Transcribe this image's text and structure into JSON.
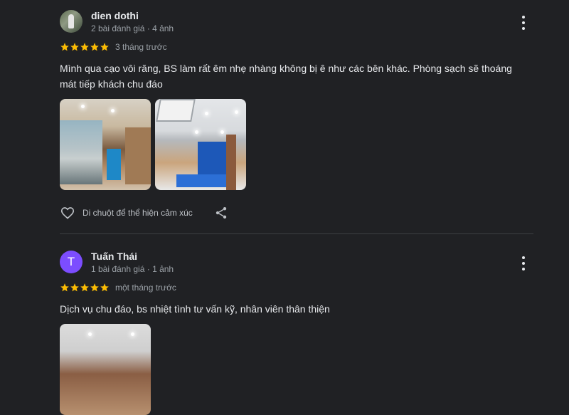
{
  "reviews": [
    {
      "name": "dien dothi",
      "meta": "2 bài đánh giá · 4 ảnh",
      "stars": 5,
      "time": "3 tháng trước",
      "text": "Mình qua cạo vôi răng, BS làm rất êm nhẹ nhàng không bị ê như các bên khác. Phòng sạch sẽ thoáng mát tiếp khách chu đáo",
      "avatar_icon": "profile-photo",
      "reaction_label": "Di chuột để thể hiện cảm xúc"
    },
    {
      "name": "Tuấn Thái",
      "meta": "1 bài đánh giá · 1 ảnh",
      "stars": 5,
      "time": "một tháng trước",
      "text": "Dịch vụ chu đáo, bs nhiệt tình tư vấn kỹ, nhân viên thân thiện",
      "avatar_letter": "T",
      "avatar_color": "#7c4dff"
    }
  ],
  "colors": {
    "background": "#202124",
    "star": "#fbbc04",
    "text": "#e8eaed",
    "muted": "#9aa0a6"
  },
  "icons": [
    "more-vert-icon",
    "star-icon",
    "heart-outline-icon",
    "share-icon"
  ]
}
